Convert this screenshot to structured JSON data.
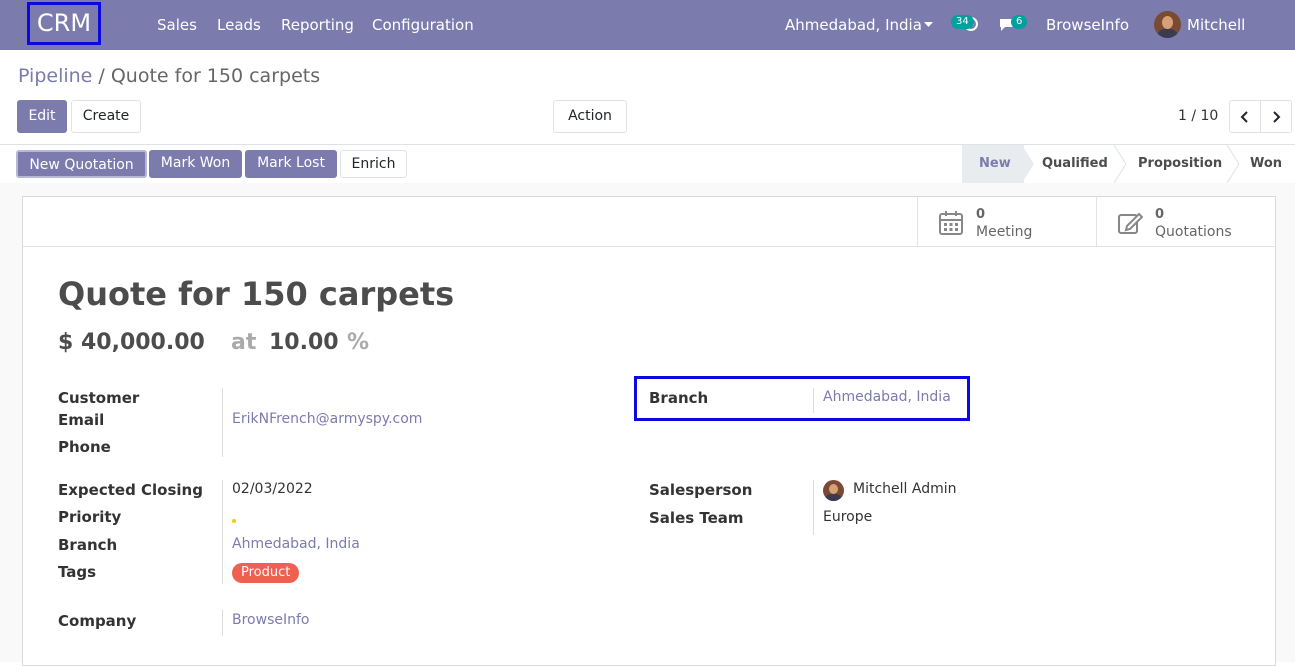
{
  "navbar": {
    "app_name": "CRM",
    "menu": [
      "Sales",
      "Leads",
      "Reporting",
      "Configuration"
    ],
    "branch": "Ahmedabad, India",
    "activity_count": "34",
    "messages_count": "6",
    "company": "BrowseInfo",
    "user": "Mitchell Admin"
  },
  "breadcrumb": {
    "parent": "Pipeline",
    "separator": " / ",
    "current": "Quote for 150 carpets"
  },
  "controls": {
    "edit": "Edit",
    "create": "Create",
    "action": "Action",
    "pager": "1 / 10"
  },
  "statusbar": {
    "buttons": [
      "New Quotation",
      "Mark Won",
      "Mark Lost",
      "Enrich"
    ],
    "stages": [
      "New",
      "Qualified",
      "Proposition",
      "Won"
    ],
    "active_stage": "New"
  },
  "smart_buttons": [
    {
      "count": "0",
      "label": "Meeting",
      "icon": "calendar-icon"
    },
    {
      "count": "0",
      "label": "Quotations",
      "icon": "edit-icon"
    }
  ],
  "record": {
    "title": "Quote for 150 carpets",
    "revenue": "$ 40,000.00",
    "at": "at",
    "probability": "10.00",
    "percent": "%"
  },
  "fields": {
    "customer_label": "Customer",
    "email_label": "Email",
    "email": "ErikNFrench@armyspy.com",
    "phone_label": "Phone",
    "branch_label": "Branch",
    "branch": "Ahmedabad, India",
    "expected_closing_label": "Expected Closing",
    "expected_closing": "02/03/2022",
    "priority_label": "Priority",
    "branch2_label": "Branch",
    "branch2": "Ahmedabad, India",
    "tags_label": "Tags",
    "tag": "Product",
    "salesperson_label": "Salesperson",
    "salesperson": "Mitchell Admin",
    "sales_team_label": "Sales Team",
    "sales_team": "Europe",
    "company_label": "Company",
    "company": "BrowseInfo"
  },
  "colors": {
    "brand": "#7c7bad",
    "highlight": "#0a0ae0",
    "tag": "#f06050",
    "badge": "#00a09d"
  }
}
